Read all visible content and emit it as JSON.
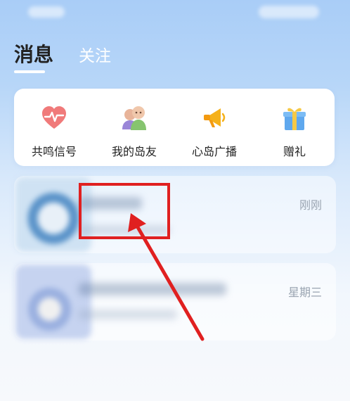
{
  "header": {
    "tabs": [
      {
        "label": "消息",
        "active": true
      },
      {
        "label": "关注",
        "active": false
      }
    ]
  },
  "quick_actions": [
    {
      "label": "共鸣信号",
      "icon": "heart-pulse-icon"
    },
    {
      "label": "我的岛友",
      "icon": "friends-icon"
    },
    {
      "label": "心岛广播",
      "icon": "megaphone-icon"
    },
    {
      "label": "赠礼",
      "icon": "gift-icon"
    }
  ],
  "messages": [
    {
      "time": "刚刚"
    },
    {
      "time": "星期三"
    }
  ],
  "colors": {
    "annotation_red": "#e02020",
    "accent_blue": "#a9cdf7"
  }
}
